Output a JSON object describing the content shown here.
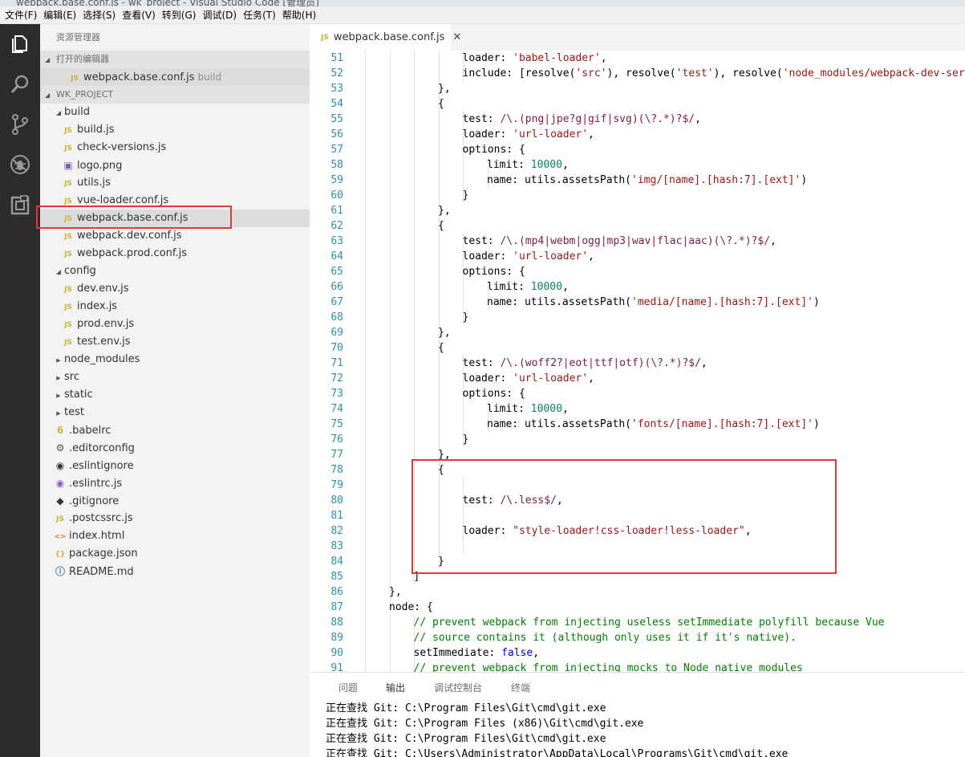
{
  "titlebar": {
    "text": "webpack.base.conf.js - wk_project - Visual Studio Code [管理员]"
  },
  "menu": [
    "文件(F)",
    "编辑(E)",
    "选择(S)",
    "查看(V)",
    "转到(G)",
    "调试(D)",
    "任务(T)",
    "帮助(H)"
  ],
  "activity": [
    "files-icon",
    "search-icon",
    "source-control-icon",
    "debug-icon",
    "extensions-icon"
  ],
  "sidebar": {
    "title": "资源管理器",
    "open_editors_label": "打开的编辑器",
    "open_editor": {
      "name": "webpack.base.conf.js",
      "hint": "build"
    },
    "project_label": "WK_PROJECT",
    "tree": [
      {
        "name": "build",
        "type": "folder-open",
        "indent": 1
      },
      {
        "name": "build.js",
        "type": "js",
        "indent": 2
      },
      {
        "name": "check-versions.js",
        "type": "js",
        "indent": 2
      },
      {
        "name": "logo.png",
        "type": "img",
        "indent": 2
      },
      {
        "name": "utils.js",
        "type": "js",
        "indent": 2
      },
      {
        "name": "vue-loader.conf.js",
        "type": "js",
        "indent": 2
      },
      {
        "name": "webpack.base.conf.js",
        "type": "js",
        "indent": 2,
        "selected": true
      },
      {
        "name": "webpack.dev.conf.js",
        "type": "js",
        "indent": 2
      },
      {
        "name": "webpack.prod.conf.js",
        "type": "js",
        "indent": 2
      },
      {
        "name": "config",
        "type": "folder-open",
        "indent": 1
      },
      {
        "name": "dev.env.js",
        "type": "js",
        "indent": 2
      },
      {
        "name": "index.js",
        "type": "js",
        "indent": 2
      },
      {
        "name": "prod.env.js",
        "type": "js",
        "indent": 2
      },
      {
        "name": "test.env.js",
        "type": "js",
        "indent": 2
      },
      {
        "name": "node_modules",
        "type": "folder",
        "indent": 1
      },
      {
        "name": "src",
        "type": "folder",
        "indent": 1
      },
      {
        "name": "static",
        "type": "folder",
        "indent": 1
      },
      {
        "name": "test",
        "type": "folder",
        "indent": 1
      },
      {
        "name": ".babelrc",
        "type": "babel",
        "indent": 1
      },
      {
        "name": ".editorconfig",
        "type": "gear",
        "indent": 1
      },
      {
        "name": ".eslintignore",
        "type": "eslint",
        "indent": 1
      },
      {
        "name": ".eslintrc.js",
        "type": "eslint2",
        "indent": 1
      },
      {
        "name": ".gitignore",
        "type": "git",
        "indent": 1
      },
      {
        "name": ".postcssrc.js",
        "type": "js",
        "indent": 1
      },
      {
        "name": "index.html",
        "type": "html",
        "indent": 1
      },
      {
        "name": "package.json",
        "type": "json",
        "indent": 1
      },
      {
        "name": "README.md",
        "type": "info",
        "indent": 1
      }
    ]
  },
  "editor": {
    "tab_label": "webpack.base.conf.js",
    "lines": [
      {
        "n": "51",
        "d": 3,
        "t": [
          [
            "",
            "loader: "
          ],
          [
            "s",
            "'babel-loader'"
          ],
          [
            "",
            ","
          ]
        ]
      },
      {
        "n": "52",
        "d": 3,
        "t": [
          [
            "",
            "include: [resolve("
          ],
          [
            "s",
            "'src'"
          ],
          [
            "",
            "), resolve("
          ],
          [
            "s",
            "'test'"
          ],
          [
            "",
            "), resolve("
          ],
          [
            "s",
            "'node_modules/webpack-dev-server/client'"
          ],
          [
            "",
            ")]"
          ]
        ]
      },
      {
        "n": "53",
        "d": 2,
        "t": [
          [
            "",
            "},"
          ]
        ]
      },
      {
        "n": "54",
        "d": 2,
        "t": [
          [
            "",
            "{"
          ]
        ]
      },
      {
        "n": "55",
        "d": 3,
        "t": [
          [
            "",
            "test: "
          ],
          [
            "r",
            "/\\.(png|jpe?g|gif|svg)(\\?.*)?$/"
          ],
          [
            "",
            ","
          ]
        ]
      },
      {
        "n": "56",
        "d": 3,
        "t": [
          [
            "",
            "loader: "
          ],
          [
            "s",
            "'url-loader'"
          ],
          [
            "",
            ","
          ]
        ]
      },
      {
        "n": "57",
        "d": 3,
        "t": [
          [
            "",
            "options: {"
          ]
        ]
      },
      {
        "n": "58",
        "d": 4,
        "t": [
          [
            "",
            "limit: "
          ],
          [
            "n",
            "10000"
          ],
          [
            "",
            ","
          ]
        ]
      },
      {
        "n": "59",
        "d": 4,
        "t": [
          [
            "",
            "name: utils.assetsPath("
          ],
          [
            "s",
            "'img/[name].[hash:7].[ext]'"
          ],
          [
            "",
            ")"
          ]
        ]
      },
      {
        "n": "60",
        "d": 3,
        "t": [
          [
            "",
            "}"
          ]
        ]
      },
      {
        "n": "61",
        "d": 2,
        "t": [
          [
            "",
            "},"
          ]
        ]
      },
      {
        "n": "62",
        "d": 2,
        "t": [
          [
            "",
            "{"
          ]
        ]
      },
      {
        "n": "63",
        "d": 3,
        "t": [
          [
            "",
            "test: "
          ],
          [
            "r",
            "/\\.(mp4|webm|ogg|mp3|wav|flac|aac)(\\?.*)?$/"
          ],
          [
            "",
            ","
          ]
        ]
      },
      {
        "n": "64",
        "d": 3,
        "t": [
          [
            "",
            "loader: "
          ],
          [
            "s",
            "'url-loader'"
          ],
          [
            "",
            ","
          ]
        ]
      },
      {
        "n": "65",
        "d": 3,
        "t": [
          [
            "",
            "options: {"
          ]
        ]
      },
      {
        "n": "66",
        "d": 4,
        "t": [
          [
            "",
            "limit: "
          ],
          [
            "n",
            "10000"
          ],
          [
            "",
            ","
          ]
        ]
      },
      {
        "n": "67",
        "d": 4,
        "t": [
          [
            "",
            "name: utils.assetsPath("
          ],
          [
            "s",
            "'media/[name].[hash:7].[ext]'"
          ],
          [
            "",
            ")"
          ]
        ]
      },
      {
        "n": "68",
        "d": 3,
        "t": [
          [
            "",
            "}"
          ]
        ]
      },
      {
        "n": "69",
        "d": 2,
        "t": [
          [
            "",
            "},"
          ]
        ]
      },
      {
        "n": "70",
        "d": 2,
        "t": [
          [
            "",
            "{"
          ]
        ]
      },
      {
        "n": "71",
        "d": 3,
        "t": [
          [
            "",
            "test: "
          ],
          [
            "r",
            "/\\.(woff2?|eot|ttf|otf)(\\?.*)?$/"
          ],
          [
            "",
            ","
          ]
        ]
      },
      {
        "n": "72",
        "d": 3,
        "t": [
          [
            "",
            "loader: "
          ],
          [
            "s",
            "'url-loader'"
          ],
          [
            "",
            ","
          ]
        ]
      },
      {
        "n": "73",
        "d": 3,
        "t": [
          [
            "",
            "options: {"
          ]
        ]
      },
      {
        "n": "74",
        "d": 4,
        "t": [
          [
            "",
            "limit: "
          ],
          [
            "n",
            "10000"
          ],
          [
            "",
            ","
          ]
        ]
      },
      {
        "n": "75",
        "d": 4,
        "t": [
          [
            "",
            "name: utils.assetsPath("
          ],
          [
            "s",
            "'fonts/[name].[hash:7].[ext]'"
          ],
          [
            "",
            ")"
          ]
        ]
      },
      {
        "n": "76",
        "d": 3,
        "t": [
          [
            "",
            "}"
          ]
        ]
      },
      {
        "n": "77",
        "d": 2,
        "t": [
          [
            "",
            "},"
          ]
        ]
      },
      {
        "n": "78",
        "d": 2,
        "t": [
          [
            "",
            "{"
          ]
        ]
      },
      {
        "n": "79",
        "d": 3,
        "t": []
      },
      {
        "n": "80",
        "d": 3,
        "t": [
          [
            "",
            "test: "
          ],
          [
            "r",
            "/\\.less$/"
          ],
          [
            "",
            ","
          ]
        ]
      },
      {
        "n": "81",
        "d": 3,
        "t": []
      },
      {
        "n": "82",
        "d": 3,
        "t": [
          [
            "",
            "loader: "
          ],
          [
            "s",
            "\"style-loader!css-loader!less-loader\""
          ],
          [
            "",
            ","
          ]
        ]
      },
      {
        "n": "83",
        "d": 3,
        "t": []
      },
      {
        "n": "84",
        "d": 2,
        "t": [
          [
            "",
            "}"
          ]
        ]
      },
      {
        "n": "85",
        "d": 1,
        "t": [
          [
            "",
            "]"
          ]
        ]
      },
      {
        "n": "86",
        "d": 0,
        "t": [
          [
            "",
            "},"
          ]
        ]
      },
      {
        "n": "87",
        "d": 0,
        "t": [
          [
            "",
            "node: {"
          ]
        ]
      },
      {
        "n": "88",
        "d": 1,
        "t": [
          [
            "c",
            "// prevent webpack from injecting useless setImmediate polyfill because Vue"
          ]
        ]
      },
      {
        "n": "89",
        "d": 1,
        "t": [
          [
            "c",
            "// source contains it (although only uses it if it's native)."
          ]
        ]
      },
      {
        "n": "90",
        "d": 1,
        "t": [
          [
            "",
            "setImmediate: "
          ],
          [
            "k",
            "false"
          ],
          [
            "",
            ","
          ]
        ]
      },
      {
        "n": "91",
        "d": 1,
        "t": [
          [
            "c",
            "// prevent webpack from injecting mocks to Node native modules"
          ]
        ]
      }
    ]
  },
  "panel": {
    "tabs": [
      "问题",
      "输出",
      "调试控制台",
      "终端"
    ],
    "active_tab": "输出",
    "output": [
      "正在查找 Git: C:\\Program Files\\Git\\cmd\\git.exe",
      "正在查找 Git: C:\\Program Files (x86)\\Git\\cmd\\git.exe",
      "正在查找 Git: C:\\Program Files\\Git\\cmd\\git.exe",
      "正在查找 Git: C:\\Users\\Administrator\\AppData\\Local\\Programs\\Git\\cmd\\git.exe"
    ]
  }
}
